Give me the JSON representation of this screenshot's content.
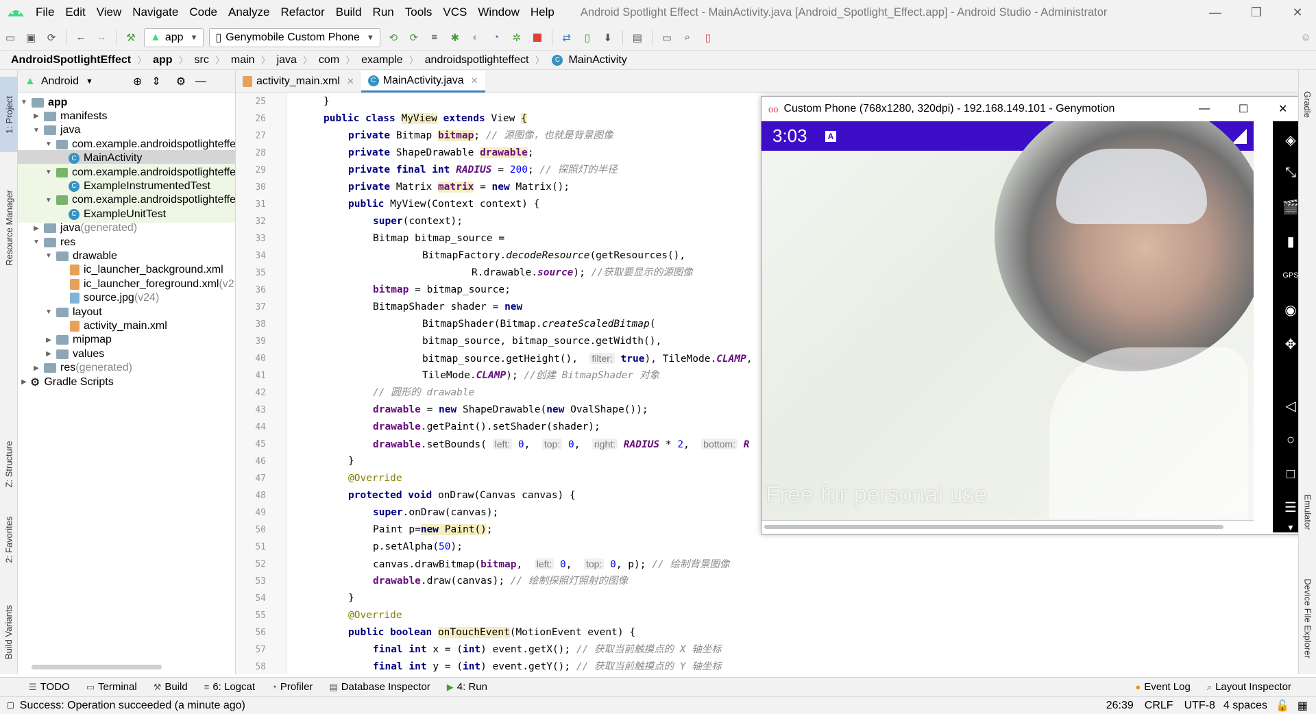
{
  "menubar": {
    "items": [
      "File",
      "Edit",
      "View",
      "Navigate",
      "Code",
      "Analyze",
      "Refactor",
      "Build",
      "Run",
      "Tools",
      "VCS",
      "Window",
      "Help"
    ],
    "window_title": "Android Spotlight Effect - MainActivity.java [Android_Spotlight_Effect.app] - Android Studio - Administrator"
  },
  "toolbar": {
    "module_combo": "app",
    "device_combo": "Genymobile Custom Phone"
  },
  "breadcrumb": [
    "AndroidSpotlightEffect",
    "app",
    "src",
    "main",
    "java",
    "com",
    "example",
    "androidspotlighteffect",
    "MainActivity"
  ],
  "left_strip": {
    "tabs": [
      "1: Project",
      "Resource Manager",
      "Z: Structure",
      "2: Favorites",
      "Build Variants"
    ]
  },
  "project": {
    "view_label": "Android",
    "tree": [
      {
        "label": "app",
        "bold": true
      },
      {
        "label": "manifests"
      },
      {
        "label": "java"
      },
      {
        "label": "com.example.androidspotlighteffe"
      },
      {
        "label": "MainActivity"
      },
      {
        "label": "com.example.androidspotlighteffe"
      },
      {
        "label": "ExampleInstrumentedTest"
      },
      {
        "label": "com.example.androidspotlighteffe"
      },
      {
        "label": "ExampleUnitTest"
      },
      {
        "label": "java",
        "suffix": " (generated)"
      },
      {
        "label": "res"
      },
      {
        "label": "drawable"
      },
      {
        "label": "ic_launcher_background.xml"
      },
      {
        "label": "ic_launcher_foreground.xml",
        "suffix": " (v2"
      },
      {
        "label": "source.jpg",
        "suffix": " (v24)"
      },
      {
        "label": "layout"
      },
      {
        "label": "activity_main.xml"
      },
      {
        "label": "mipmap"
      },
      {
        "label": "values"
      },
      {
        "label": "res",
        "suffix": " (generated)"
      },
      {
        "label": "Gradle Scripts"
      }
    ]
  },
  "editor": {
    "tabs": [
      {
        "label": "activity_main.xml",
        "active": false
      },
      {
        "label": "MainActivity.java",
        "active": true
      }
    ],
    "line_numbers": [
      "25",
      "26",
      "27",
      "28",
      "29",
      "30",
      "31",
      "32",
      "33",
      "34",
      "35",
      "36",
      "37",
      "38",
      "39",
      "40",
      "41",
      "42",
      "43",
      "44",
      "45",
      "46",
      "47",
      "48",
      "49",
      "50",
      "51",
      "52",
      "53",
      "54",
      "55",
      "56",
      "57",
      "58"
    ]
  },
  "emulator": {
    "title": "Custom Phone (768x1280, 320dpi) - 192.168.149.101 - Genymotion",
    "clock": "3:03",
    "watermark": "Free for personal use"
  },
  "bottom_tabs": [
    "TODO",
    "Terminal",
    "Build",
    "6: Logcat",
    "Profiler",
    "Database Inspector",
    "4: Run"
  ],
  "bottom_right_tabs": [
    "Event Log",
    "Layout Inspector"
  ],
  "status": {
    "message": "Success: Operation succeeded (a minute ago)",
    "position": "26:39",
    "line_sep": "CRLF",
    "encoding": "UTF-8",
    "indent": "4 spaces"
  },
  "right_strip": {
    "tabs": [
      "Gradle",
      "Emulator",
      "Device File Explorer"
    ]
  },
  "colors": {
    "accent": "#4083c9",
    "statusbar": "#3c0ec7",
    "keyword": "#000080",
    "field": "#660e7a",
    "comment": "#8c8c8c"
  }
}
